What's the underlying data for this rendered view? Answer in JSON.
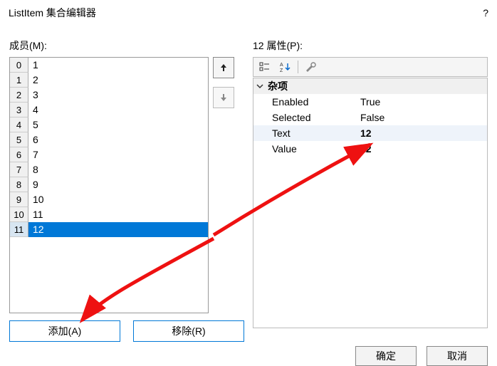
{
  "window": {
    "title": "ListItem 集合编辑器",
    "help": "?"
  },
  "members": {
    "label": "成员(M):",
    "items": [
      {
        "index": "0",
        "value": "1"
      },
      {
        "index": "1",
        "value": "2"
      },
      {
        "index": "2",
        "value": "3"
      },
      {
        "index": "3",
        "value": "4"
      },
      {
        "index": "4",
        "value": "5"
      },
      {
        "index": "5",
        "value": "6"
      },
      {
        "index": "6",
        "value": "7"
      },
      {
        "index": "7",
        "value": "8"
      },
      {
        "index": "8",
        "value": "9"
      },
      {
        "index": "9",
        "value": "10"
      },
      {
        "index": "10",
        "value": "11"
      },
      {
        "index": "11",
        "value": "12"
      }
    ],
    "selected_index": 11,
    "add_label": "添加(A)",
    "remove_label": "移除(R)",
    "up_glyph": "⬆",
    "down_glyph": "⬇"
  },
  "properties": {
    "label": "12 属性(P):",
    "category": "杂项",
    "rows": [
      {
        "name": "Enabled",
        "value": "True",
        "bold": false,
        "sel": false
      },
      {
        "name": "Selected",
        "value": "False",
        "bold": false,
        "sel": false
      },
      {
        "name": "Text",
        "value": "12",
        "bold": true,
        "sel": true
      },
      {
        "name": "Value",
        "value": "12",
        "bold": true,
        "sel": false
      }
    ],
    "toolbar_icons": [
      "categorized-icon",
      "alpha-sort-icon",
      "properties-icon"
    ]
  },
  "dialog": {
    "ok_label": "确定",
    "cancel_label": "取消"
  }
}
